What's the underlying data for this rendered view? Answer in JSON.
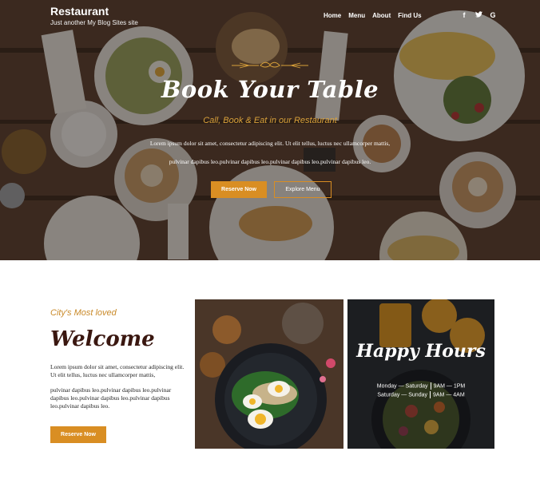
{
  "header": {
    "site_title": "Restaurant",
    "tagline": "Just another My Blog Sites site",
    "nav": [
      "Home",
      "Menu",
      "About",
      "Find Us"
    ],
    "social": [
      {
        "icon": "facebook-icon",
        "glyph": "f"
      },
      {
        "icon": "twitter-icon",
        "glyph": "t"
      },
      {
        "icon": "google-icon",
        "glyph": "G"
      }
    ]
  },
  "hero": {
    "title": "Book Your Table",
    "subtitle": "Call, Book & Eat in our Restaurant",
    "text_line1": "Lorem ipsum dolor sit amet, consectetur adipiscing elit. Ut elit tellus, luctus nec ullamcorper mattis,",
    "text_line2": "pulvinar dapibus leo.pulvinar dapibus leo.pulvinar dapibus leo.pulvinar dapibus leo.",
    "reserve_label": "Reserve Now",
    "explore_label": "Explore Menu"
  },
  "welcome": {
    "kicker": "City's Most loved",
    "title": "Welcome",
    "p1": "Lorem ipsum dolor sit amet, consectetur adipiscing elit. Ut elit tellus, luctus nec ullamcorper mattis,",
    "p2": "pulvinar dapibus leo.pulvinar dapibus leo.pulvinar dapibus leo.pulvinar dapibus leo.pulvinar dapibus leo.pulvinar dapibus leo.",
    "reserve_label": "Reserve Now"
  },
  "happy_hours": {
    "title": "Happy Hours",
    "rows": [
      {
        "days": "Monday — Saturday",
        "hours": "9AM — 1PM"
      },
      {
        "days": "Saturday — Sunday",
        "hours": "9AM — 4AM"
      }
    ]
  },
  "colors": {
    "accent": "#d98e23",
    "kicker": "#c98a2a",
    "welcome_title": "#3a1710"
  }
}
